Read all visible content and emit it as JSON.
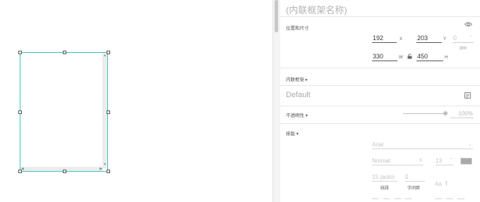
{
  "inspector": {
    "name_placeholder": "(内联框架名称)",
    "position_size_label": "位置和尺寸",
    "x_value": "192",
    "x_unit": "X",
    "y_value": "203",
    "y_unit": "Y",
    "rotation_value": "0",
    "rotation_label": "旋转",
    "w_value": "330",
    "w_unit": "W",
    "h_value": "450",
    "h_unit": "H",
    "frame_section_label": "内联框架 ▸",
    "style_default": "Default",
    "opacity_label": "不透明性 ▾",
    "opacity_value": "100%",
    "typography_label": "排版 ▾",
    "font_family": "Arial",
    "font_weight": "Normal",
    "font_size": "13",
    "line_spacing_value": "15 (auto)",
    "line_spacing_label": "线段",
    "char_spacing_value": "0",
    "char_spacing_label": "字间距"
  },
  "colors": {
    "selection": "#39c3c9",
    "text_swatch": "#a9a9a9"
  },
  "icons": {
    "visibility": "eye-icon",
    "lock": "lock-icon",
    "style_edit": "style-edit-icon"
  }
}
